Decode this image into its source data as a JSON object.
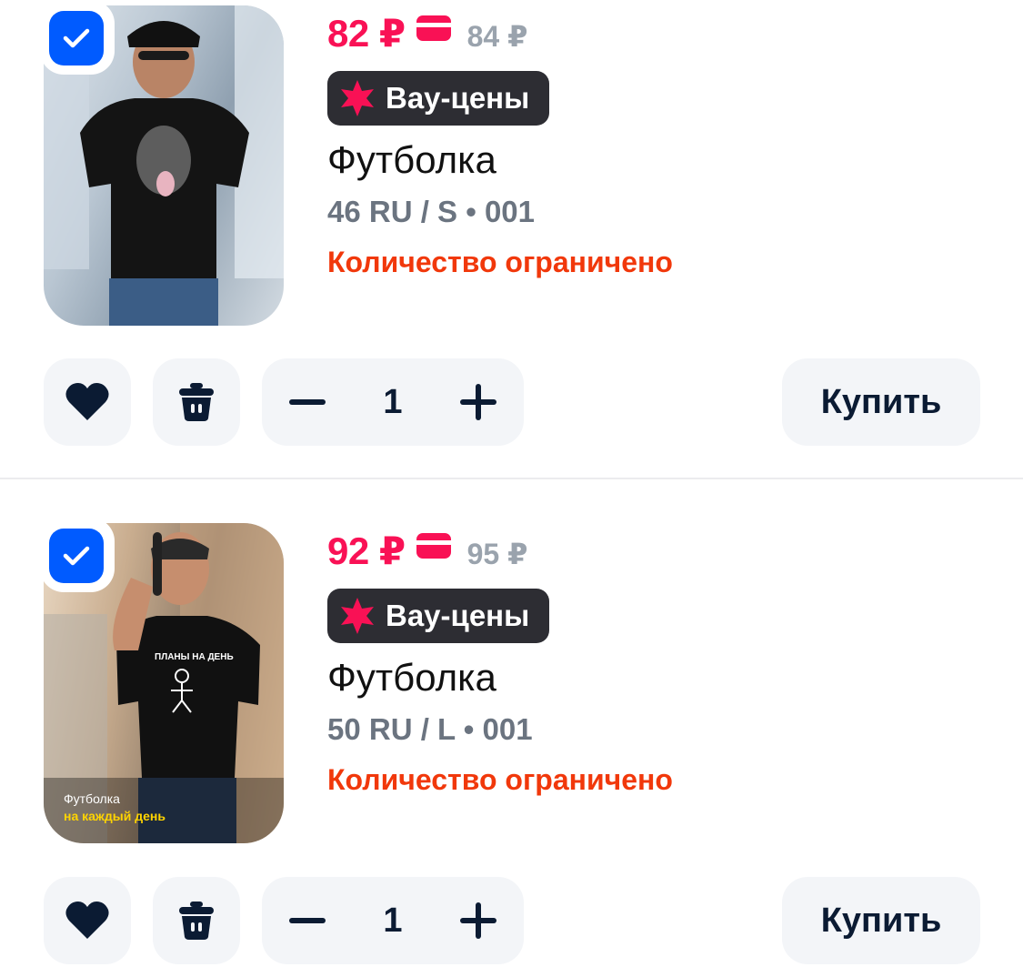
{
  "colors": {
    "accent": "#005bff",
    "price": "#f91155",
    "stock": "#f1380b",
    "badge_bg": "#2d2d33"
  },
  "items": [
    {
      "checked": true,
      "price": "82 ₽",
      "old_price": "84 ₽",
      "badge": "Вау-цены",
      "title": "Футболка",
      "variant": "46 RU / S • 001",
      "stock": "Количество ограничено",
      "quantity": "1",
      "buy_label": "Купить",
      "image_icon": "tshirt-photo"
    },
    {
      "checked": true,
      "price": "92 ₽",
      "old_price": "95 ₽",
      "badge": "Вау-цены",
      "title": "Футболка",
      "variant": "50 RU / L • 001",
      "stock": "Количество ограничено",
      "quantity": "1",
      "buy_label": "Купить",
      "image_icon": "tshirt-photo",
      "image_text": [
        "ПЛАНЫ НА ДЕНЬ",
        "Футболка",
        "на каждый день"
      ]
    }
  ]
}
